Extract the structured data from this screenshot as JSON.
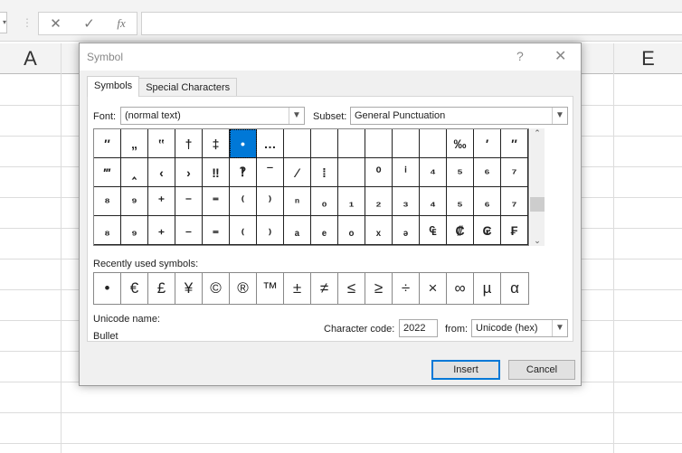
{
  "formula_bar": {
    "cancel_icon": "✕",
    "enter_icon": "✓",
    "fx_label": "fx",
    "value": ""
  },
  "columns": [
    "A",
    "E"
  ],
  "dialog": {
    "title": "Symbol",
    "help": "?",
    "close": "✕",
    "tabs": [
      {
        "label": "Symbols",
        "active": true
      },
      {
        "label": "Special Characters",
        "active": false
      }
    ],
    "font_label": "Font:",
    "font_value": "(normal text)",
    "subset_label": "Subset:",
    "subset_value": "General Punctuation",
    "symbols": [
      "″",
      "„",
      "‟",
      "†",
      "‡",
      "•",
      "…",
      "",
      "",
      "",
      "",
      "",
      "",
      "‰",
      "′",
      "″",
      "‴",
      "‸",
      "‹",
      "›",
      "‼",
      "‽",
      "‾",
      "⁄",
      "⁞",
      "",
      "⁰",
      "ⁱ",
      "⁴",
      "⁵",
      "⁶",
      "⁷",
      "⁸",
      "⁹",
      "⁺",
      "⁻",
      "⁼",
      "⁽",
      "⁾",
      "ⁿ",
      "₀",
      "₁",
      "₂",
      "₃",
      "₄",
      "₅",
      "₆",
      "₇",
      "₈",
      "₉",
      "₊",
      "₋",
      "₌",
      "₍",
      "₎",
      "ₐ",
      "ₑ",
      "ₒ",
      "ₓ",
      "ₔ",
      "₠",
      "₡",
      "₢",
      "₣"
    ],
    "selected_index": 5,
    "recent_label": "Recently used symbols:",
    "recent": [
      "•",
      "€",
      "£",
      "¥",
      "©",
      "®",
      "™",
      "±",
      "≠",
      "≤",
      "≥",
      "÷",
      "×",
      "∞",
      "µ",
      "α"
    ],
    "unicode_name_label": "Unicode name:",
    "unicode_name": "Bullet",
    "char_code_label": "Character code:",
    "char_code": "2022",
    "from_label": "from:",
    "from_value": "Unicode (hex)",
    "insert": "Insert",
    "cancel": "Cancel"
  }
}
